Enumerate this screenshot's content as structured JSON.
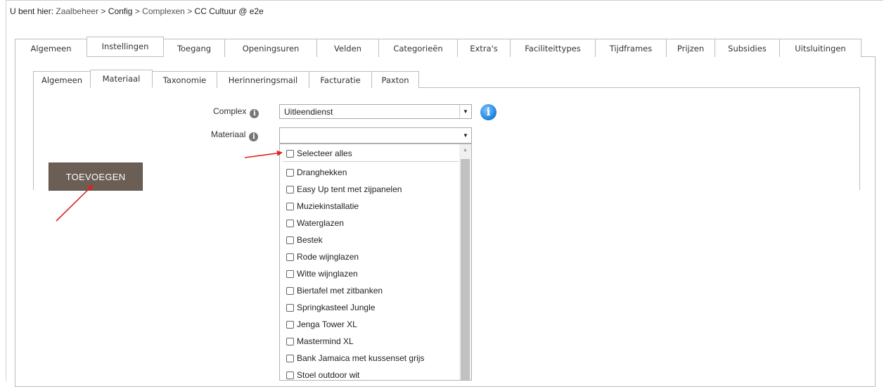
{
  "breadcrumb": {
    "prefix": "U bent hier: ",
    "items": [
      "Zaalbeheer",
      "Config",
      "Complexen",
      "CC Cultuur @ e2e"
    ],
    "separator": " > "
  },
  "main_tabs": [
    {
      "label": "Algemeen",
      "active": false
    },
    {
      "label": "Instellingen",
      "active": true
    },
    {
      "label": "Toegang",
      "active": false
    },
    {
      "label": "Openingsuren",
      "active": false
    },
    {
      "label": "Velden",
      "active": false
    },
    {
      "label": "Categorieën",
      "active": false
    },
    {
      "label": "Extra's",
      "active": false
    },
    {
      "label": "Faciliteittypes",
      "active": false
    },
    {
      "label": "Tijdframes",
      "active": false
    },
    {
      "label": "Prijzen",
      "active": false
    },
    {
      "label": "Subsidies",
      "active": false
    },
    {
      "label": "Uitsluitingen",
      "active": false
    }
  ],
  "sub_tabs": [
    {
      "label": "Algemeen",
      "active": false
    },
    {
      "label": "Materiaal",
      "active": true
    },
    {
      "label": "Taxonomie",
      "active": false
    },
    {
      "label": "Herinneringsmail",
      "active": false
    },
    {
      "label": "Facturatie",
      "active": false
    },
    {
      "label": "Paxton",
      "active": false
    }
  ],
  "form": {
    "complex_label": "Complex",
    "complex_value": "Uitleendienst",
    "materiaal_label": "Materiaal",
    "materiaal_value": ""
  },
  "add_button": "TOEVOEGEN",
  "dropdown": {
    "select_all": "Selecteer alles",
    "options": [
      "Dranghekken",
      "Easy Up tent met zijpanelen",
      "Muziekinstallatie",
      "Waterglazen",
      "Bestek",
      "Rode wijnglazen",
      "Witte wijnglazen",
      "Biertafel met zitbanken",
      "Springkasteel Jungle",
      "Jenga Tower XL",
      "Mastermind XL",
      "Bank Jamaica met kussenset grijs",
      "Stoel outdoor wit"
    ]
  },
  "colors": {
    "button_bg": "#6b5e55",
    "annotation_arrow": "#e0201e",
    "info_blue": "#1a7fd8"
  }
}
